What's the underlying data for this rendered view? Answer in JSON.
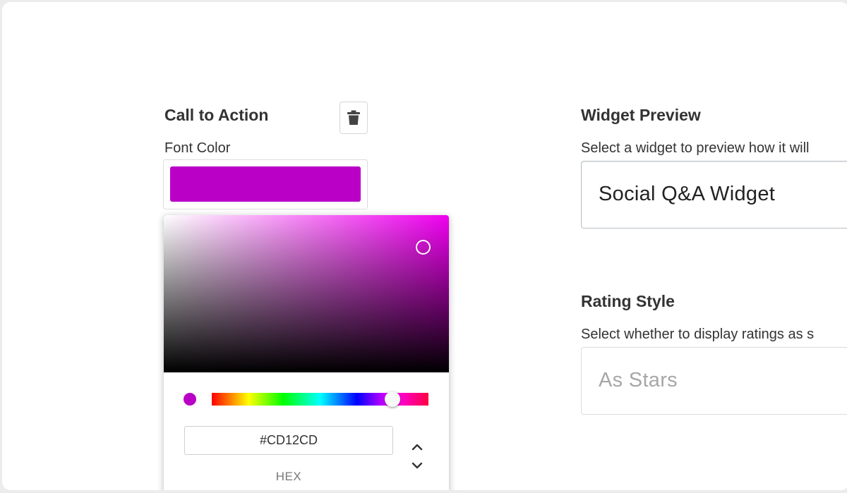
{
  "call_to_action": {
    "title": "Call to Action",
    "delete_icon": "trash-icon",
    "font_color_label": "Font Color",
    "font_color_value": "#BA00C6"
  },
  "color_picker": {
    "hue_color": "#F000F0",
    "current_color": "#BA00C6",
    "hex_value": "#CD12CD",
    "hex_label": "HEX",
    "mode_toggle_icon": "chevron-up-down-icon"
  },
  "widget_preview": {
    "title": "Widget Preview",
    "description": "Select a widget to preview how it will",
    "selected": "Social Q&A Widget"
  },
  "rating_style": {
    "title": "Rating Style",
    "description": "Select whether to display ratings as s",
    "selected": "As Stars"
  }
}
